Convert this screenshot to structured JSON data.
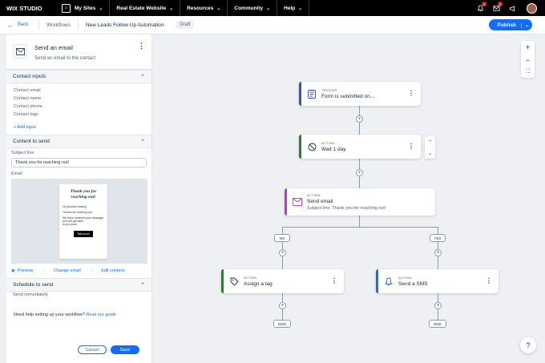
{
  "topbar": {
    "logo": "WIX STUDIO",
    "menu": [
      {
        "label": "My Sites"
      },
      {
        "label": "Real Estate Website"
      },
      {
        "label": "Resources"
      },
      {
        "label": "Community"
      },
      {
        "label": "Help"
      }
    ],
    "badges": [
      "4",
      "5"
    ]
  },
  "subbar": {
    "back": "Back",
    "crumb_workflows": "Workflows",
    "automation_name": "New Leads Follow Up Automation",
    "status": "Draft",
    "publish": "Publish"
  },
  "panel": {
    "step_title": "Send an email",
    "step_sub": "Send an email to the contact",
    "contact_inputs_title": "Contact inputs",
    "contact_inputs": [
      "Contact email",
      "Contact name",
      "Contact phone",
      "Contact tags"
    ],
    "add_input": "+ Add input",
    "content_title": "Content to send",
    "subject_label": "Subject line",
    "subject_value": "Thank you for reaching out!",
    "email_label": "Email",
    "email_preview": {
      "title": "Thank you for reaching out!",
      "greeting": "Hi {{contact.name}},",
      "body1": "Thanks for reaching out.",
      "body2": "We have received your message and will get back",
      "body3": "to you soon.",
      "button": "Talk soon!"
    },
    "preview": "Preview",
    "change_email": "Change email",
    "edit_content": "Edit content",
    "schedule_title": "Schedule to send",
    "schedule_value": "Send immediately",
    "help_text": "Need help setting up your workflow?",
    "help_link": "Read our guide",
    "cancel": "Cancel",
    "save": "Save"
  },
  "canvas": {
    "trigger": {
      "label": "TRIGGER",
      "title": "Form is submitted on..."
    },
    "wait": {
      "label": "ACTION",
      "title": "Wait 1 day"
    },
    "send": {
      "label": "ACTION",
      "title": "Send email",
      "sub": "Subject line: Thank you for reaching out!"
    },
    "branch_no": "NO",
    "branch_yes": "YES",
    "tag": {
      "label": "ACTION",
      "title": "Assign a tag"
    },
    "sms": {
      "label": "ACTION",
      "title": "Send a SMS"
    },
    "end": "END"
  },
  "colors": {
    "accent": "#116dff",
    "trigger_bar": "#3b4dcc",
    "wait_bar": "#2e7d32",
    "email_bar": "#b13ce0",
    "tag_bar": "#2e7d32",
    "sms_bar": "#116dff"
  }
}
